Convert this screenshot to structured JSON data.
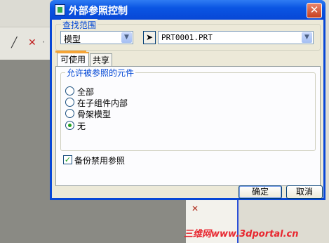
{
  "dialog": {
    "title": "外部参照控制",
    "search_scope": {
      "legend": "查找范围",
      "scope_value": "模型",
      "model_value": "PRT0001.PRT"
    },
    "tabs": [
      {
        "label": "可使用"
      },
      {
        "label": "共享"
      }
    ],
    "allowed_components": {
      "legend": "允许被参照的元件",
      "options": [
        {
          "label": "全部",
          "selected": false
        },
        {
          "label": "在子组件内部",
          "selected": false
        },
        {
          "label": "骨架模型",
          "selected": false
        },
        {
          "label": "无",
          "selected": true
        }
      ]
    },
    "backup_checkbox": {
      "label": "备份禁用参照",
      "checked": true
    },
    "ok_label": "确定",
    "cancel_label": "取消"
  },
  "watermark": "三维网www.3dportal.cn"
}
